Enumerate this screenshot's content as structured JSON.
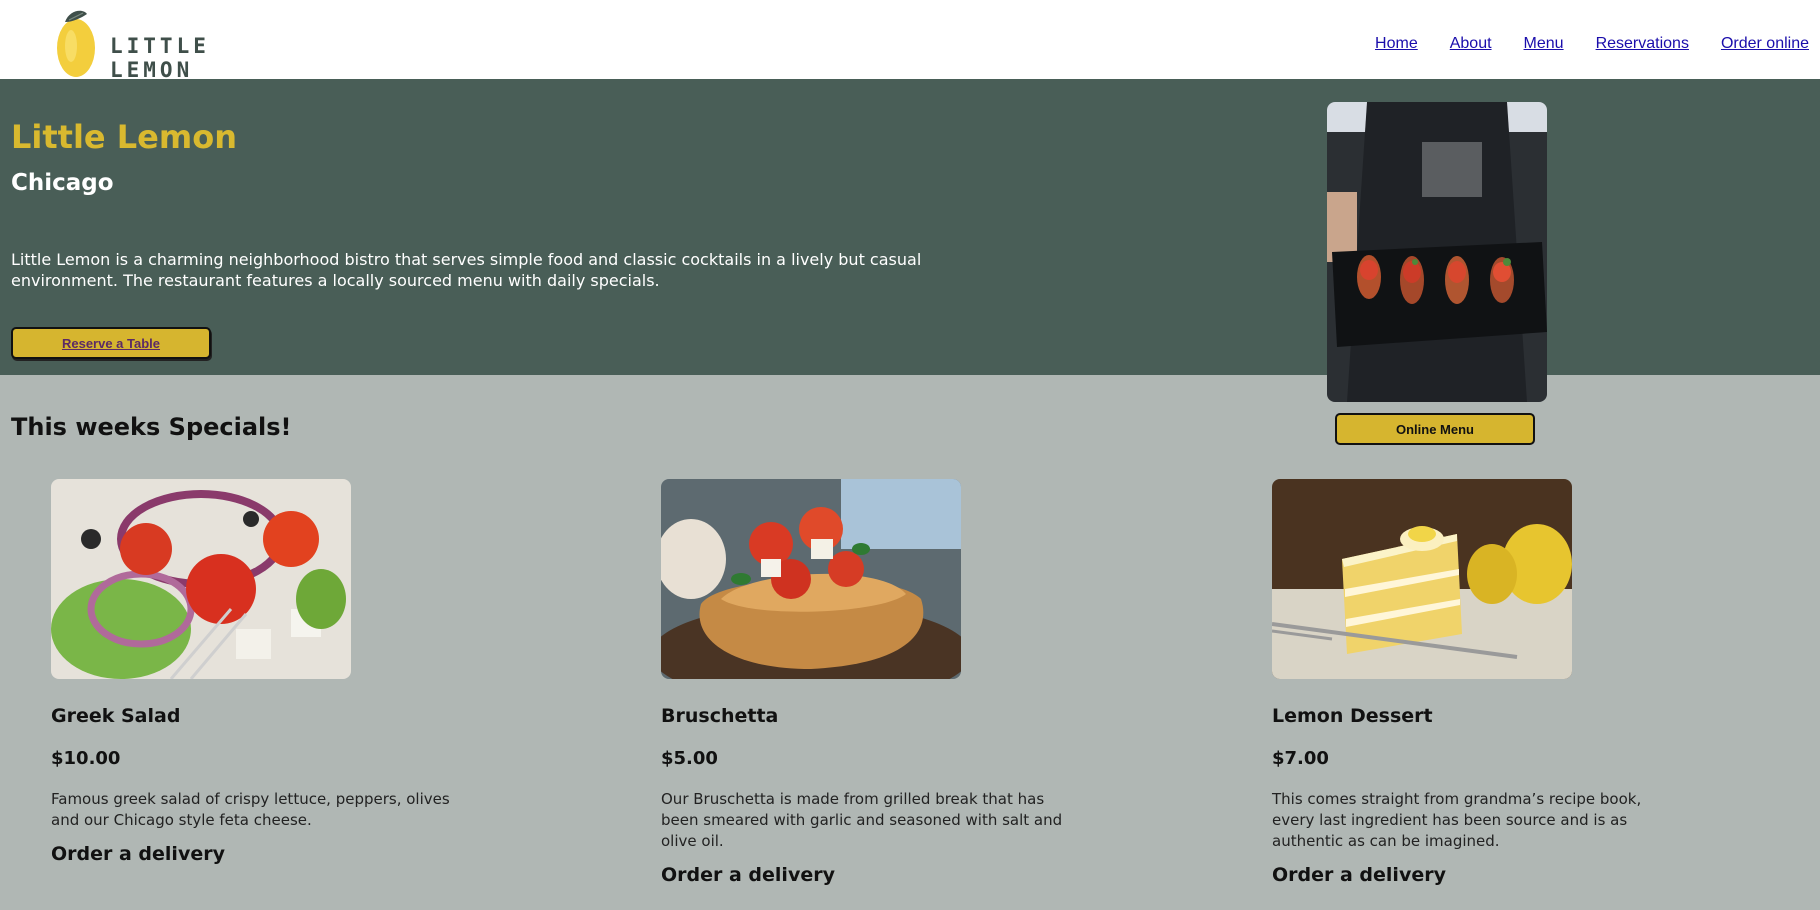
{
  "brand": {
    "logo_text": "LITTLE LEMON"
  },
  "nav": {
    "home": "Home",
    "about": "About",
    "menu": "Menu",
    "reservations": "Reservations",
    "order_online": "Order online"
  },
  "hero": {
    "title": "Little Lemon",
    "subtitle": "Chicago",
    "description": "Little Lemon is a charming neighborhood bistro that serves simple food and classic cocktails in a lively but casual environment. The restaurant features a locally sourced menu with daily specials.",
    "reserve_label": "Reserve a Table",
    "online_menu_label": "Online Menu"
  },
  "specials": {
    "title": "This weeks Specials!",
    "items": [
      {
        "name": "Greek Salad",
        "price": "$10.00",
        "description": "Famous greek salad of crispy lettuce, peppers, olives and our Chicago style feta cheese.",
        "order_label": "Order a delivery"
      },
      {
        "name": "Bruschetta",
        "price": "$5.00",
        "description": "Our Bruschetta is made from grilled break that has been smeared with garlic and seasoned with salt and olive oil.",
        "order_label": "Order a delivery"
      },
      {
        "name": "Lemon Dessert",
        "price": "$7.00",
        "description": "This comes straight from grandma’s recipe book, every last ingredient has been source and is as authentic as can be imagined.",
        "order_label": "Order a delivery"
      }
    ]
  },
  "colors": {
    "primary_green": "#495e57",
    "primary_yellow": "#d6b52f",
    "page_bg": "#b0b7b4"
  }
}
